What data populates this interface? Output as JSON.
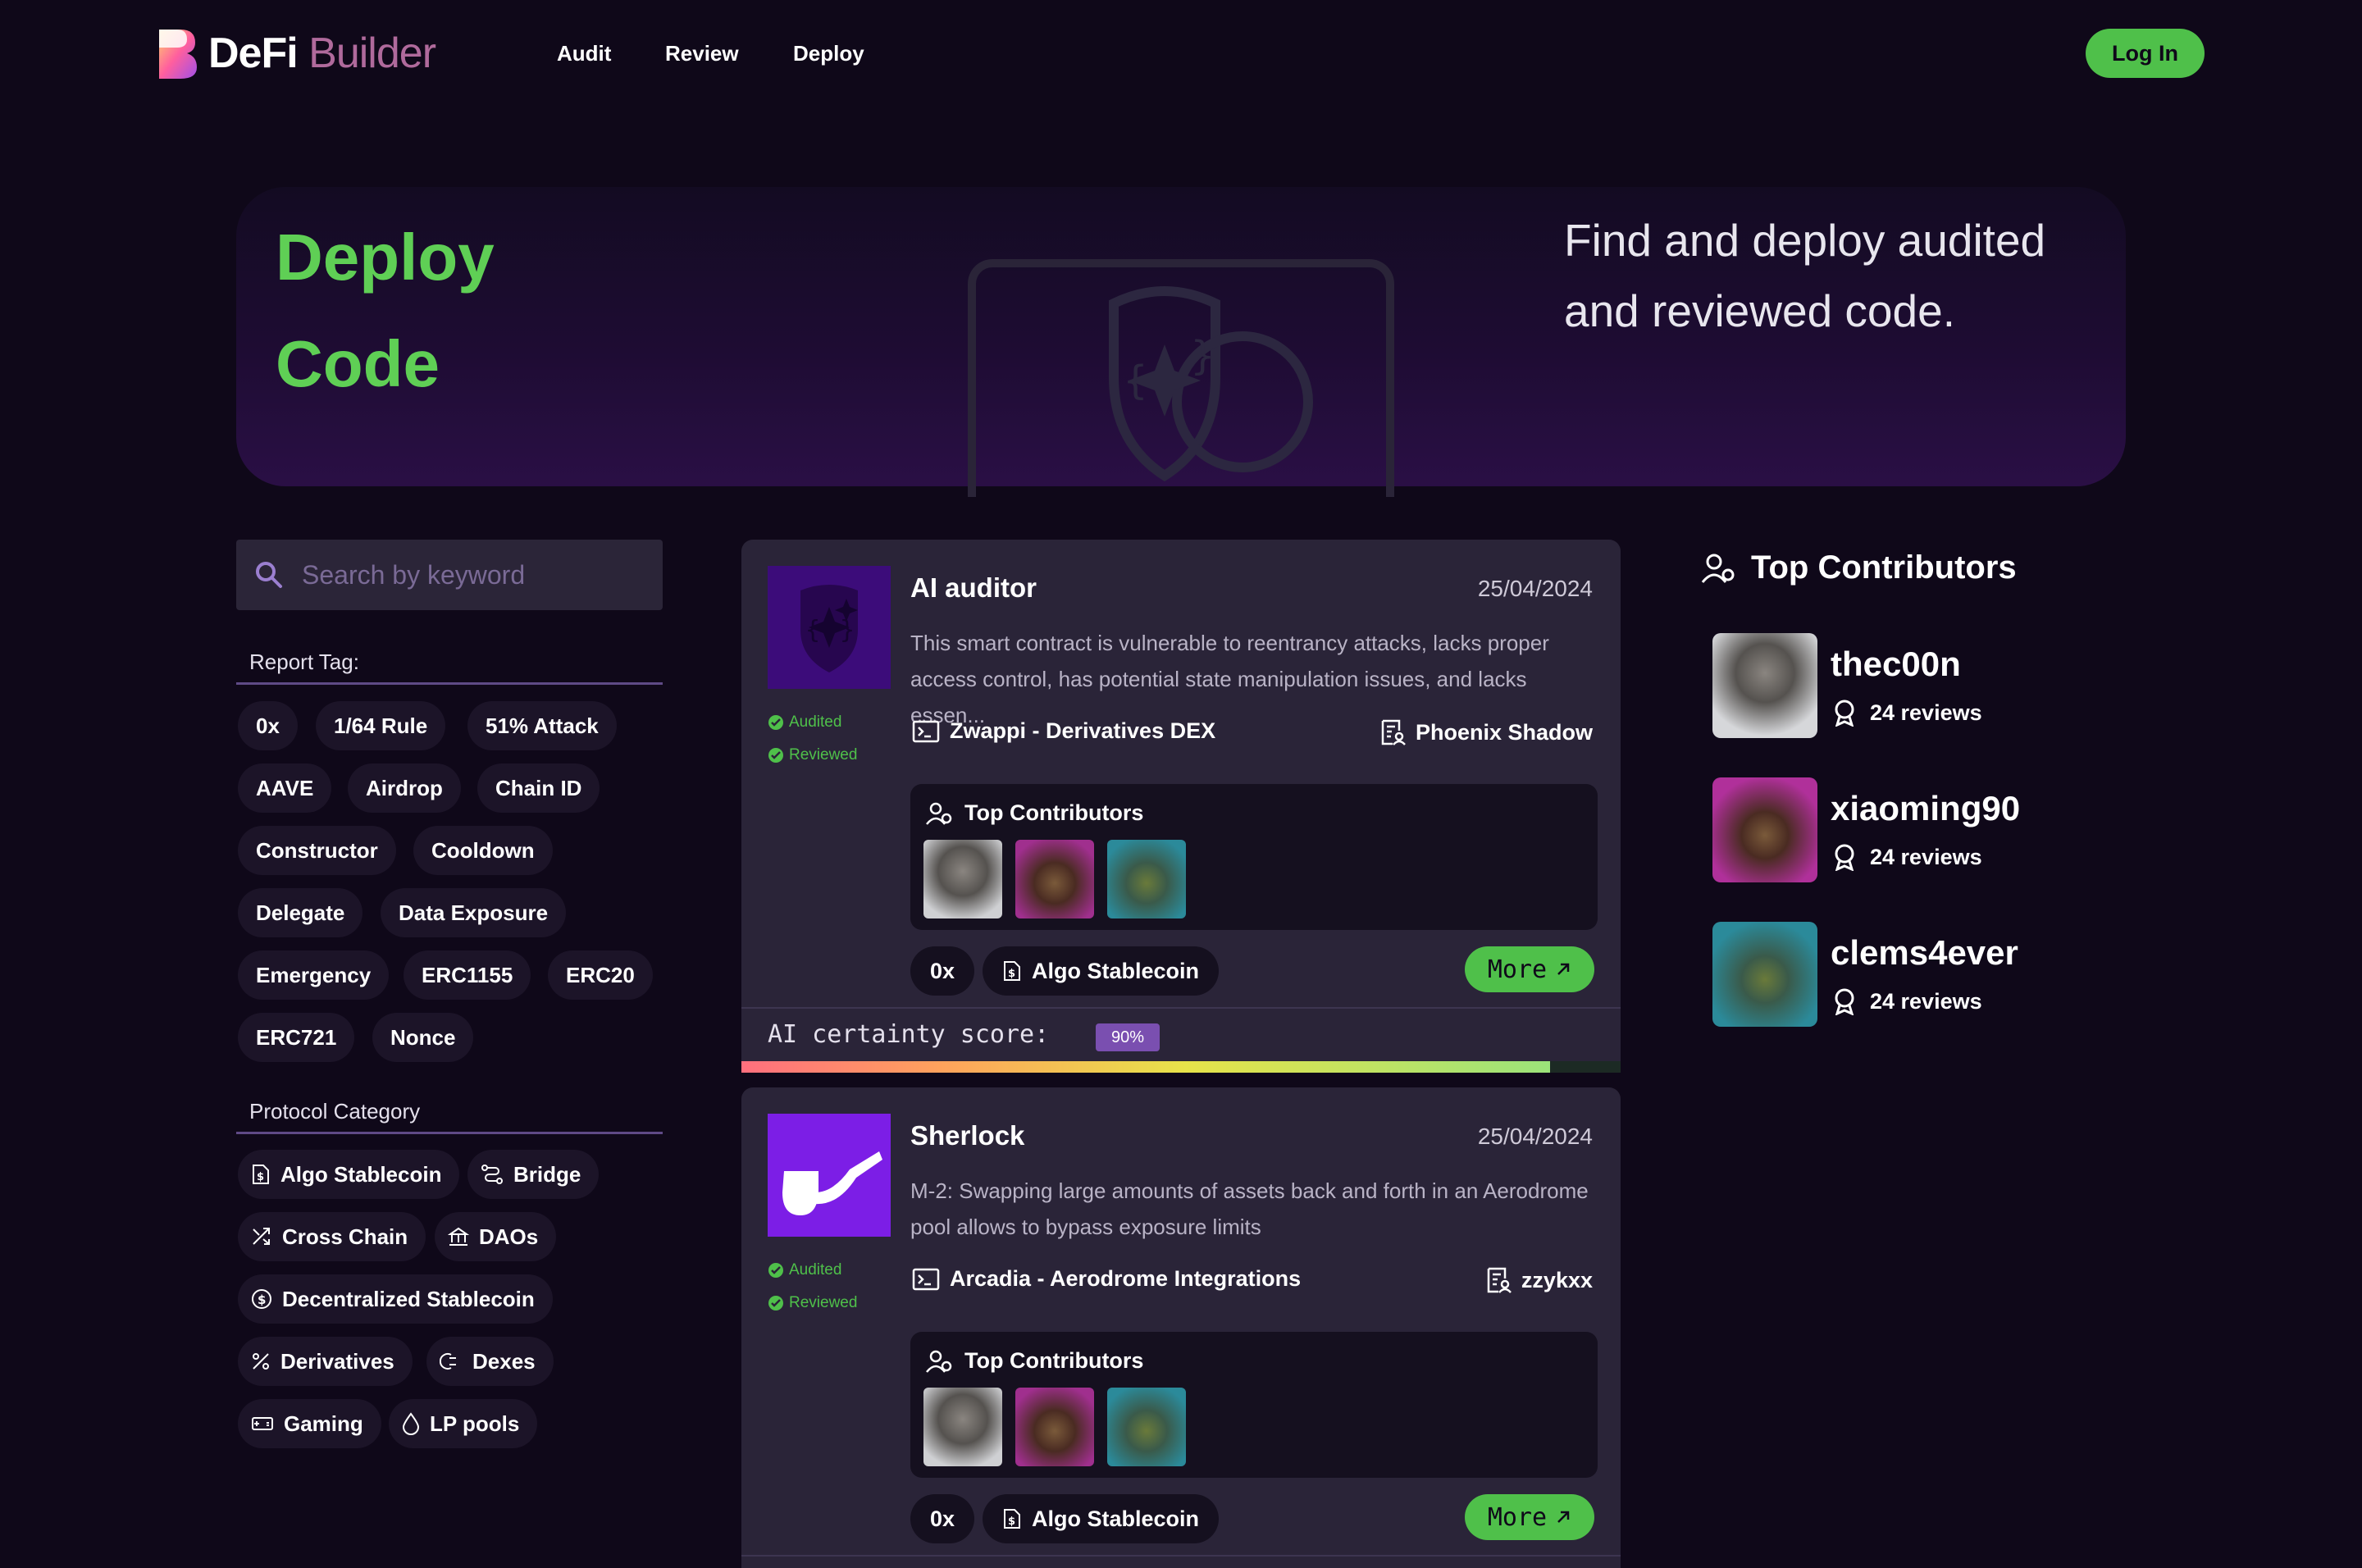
{
  "header": {
    "logo_main": "DeFi",
    "logo_sub": "Builder",
    "nav": [
      "Audit",
      "Review",
      "Deploy"
    ],
    "login_label": "Log In"
  },
  "hero": {
    "title_line1": "Deploy",
    "title_line2": "Code",
    "subtitle_line1": "Find and deploy audited",
    "subtitle_line2": "and reviewed code."
  },
  "sidebar": {
    "search_placeholder": "Search by keyword",
    "report_tag_label": "Report Tag:",
    "report_tags": [
      "0x",
      "1/64 Rule",
      "51% Attack",
      "AAVE",
      "Airdrop",
      "Chain ID",
      "Constructor",
      "Cooldown",
      "Delegate",
      "Data Exposure",
      "Emergency",
      "ERC1155",
      "ERC20",
      "ERC721",
      "Nonce"
    ],
    "protocol_category_label": "Protocol Category",
    "categories": [
      {
        "label": "Algo Stablecoin",
        "icon": "document-dollar-icon"
      },
      {
        "label": "Bridge",
        "icon": "route-icon"
      },
      {
        "label": "Cross Chain",
        "icon": "shuffle-icon"
      },
      {
        "label": "DAOs",
        "icon": "bank-icon"
      },
      {
        "label": "Decentralized Stablecoin",
        "icon": "coin-dollar-icon"
      },
      {
        "label": "Derivatives",
        "icon": "percent-icon"
      },
      {
        "label": "Dexes",
        "icon": "exchange-icon"
      },
      {
        "label": "Gaming",
        "icon": "ticket-icon"
      },
      {
        "label": "LP pools",
        "icon": "droplet-icon"
      }
    ]
  },
  "cards": [
    {
      "title": "AI auditor",
      "date": "25/04/2024",
      "desc_line1": "This smart contract is vulnerable to reentrancy attacks, lacks proper",
      "desc_line2": "access control, has potential state manipulation issues, and lacks essen...",
      "audited": "Audited",
      "reviewed": "Reviewed",
      "project": "Zwappi - Derivatives DEX",
      "reviewer": "Phoenix Shadow",
      "contributors_title": "Top Contributors",
      "tag": "0x",
      "category": "Algo Stablecoin",
      "more": "More",
      "certainty_label": "AI certainty score:",
      "certainty_value": "90%",
      "certainty_fraction": 0.92,
      "icon": "shield-sparkle-icon"
    },
    {
      "title": "Sherlock",
      "date": "25/04/2024",
      "desc_line1": "M-2: Swapping large amounts of assets back and forth in an Aerodrome",
      "desc_line2": "pool allows to bypass exposure limits",
      "audited": "Audited",
      "reviewed": "Reviewed",
      "project": "Arcadia - Aerodrome Integrations",
      "reviewer": "zzykxx",
      "contributors_title": "Top Contributors",
      "tag": "0x",
      "category": "Algo Stablecoin",
      "more": "More",
      "icon": "pipe-icon"
    }
  ],
  "top_contributors": {
    "title": "Top Contributors",
    "people": [
      {
        "name": "thec00n",
        "reviews": "24 reviews"
      },
      {
        "name": "xiaoming90",
        "reviews": "24 reviews"
      },
      {
        "name": "clems4ever",
        "reviews": "24 reviews"
      }
    ]
  },
  "colors": {
    "accent_green": "#4fc04a",
    "purple": "#7c1ee6",
    "background": "#0f0819"
  }
}
